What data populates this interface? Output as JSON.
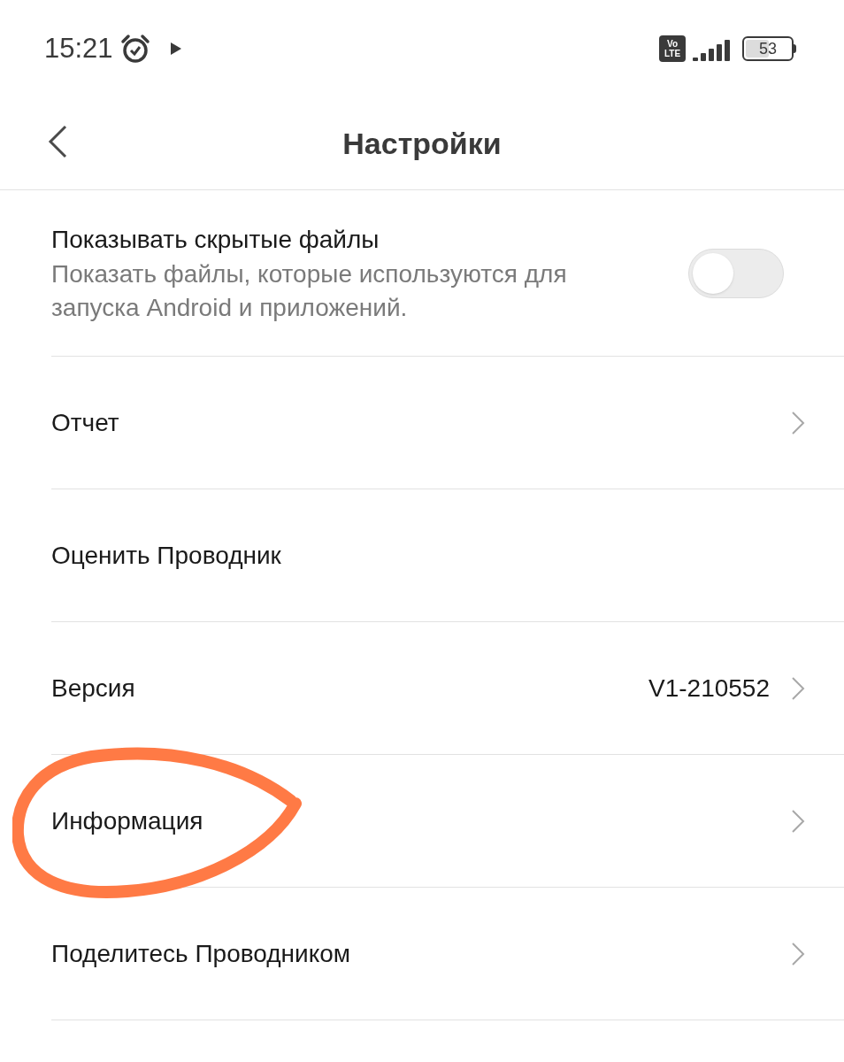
{
  "status_bar": {
    "time": "15:21",
    "volte": [
      "Vo",
      "LTE"
    ],
    "battery": "53"
  },
  "header": {
    "title": "Настройки"
  },
  "rows": [
    {
      "kind": "toggle",
      "label": "Показывать скрытые файлы",
      "description": "Показать файлы, которые используются для запуска Android и приложений.",
      "on": false
    },
    {
      "kind": "link",
      "label": "Отчет"
    },
    {
      "kind": "plain",
      "label": "Оценить Проводник"
    },
    {
      "kind": "link",
      "label": "Версия",
      "value": "V1-210552"
    },
    {
      "kind": "link",
      "label": "Информация",
      "circled": true
    },
    {
      "kind": "link",
      "label": "Поделитесь Проводником"
    }
  ]
}
